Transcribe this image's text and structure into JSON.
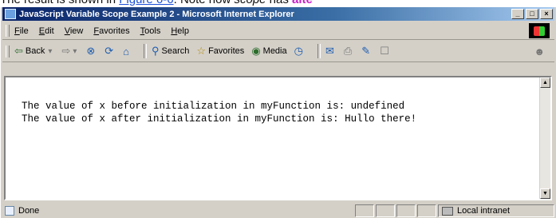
{
  "caption": {
    "prefix": "The result is shown in ",
    "link": "Figure 6-6",
    "middle": ". Note how ",
    "emphasis": "scope",
    "suffix": " has ",
    "highlight": "alte"
  },
  "window": {
    "title": "JavaScript Variable Scope Example 2 - Microsoft Internet Explorer",
    "controls": {
      "minimize": "_",
      "maximize": "□",
      "close": "×"
    }
  },
  "menu": {
    "items": [
      {
        "label": "File"
      },
      {
        "label": "Edit"
      },
      {
        "label": "View"
      },
      {
        "label": "Favorites"
      },
      {
        "label": "Tools"
      },
      {
        "label": "Help"
      }
    ]
  },
  "toolbar": {
    "back": {
      "label": "Back",
      "icon": "back-arrow-icon",
      "glyph": "⇦"
    },
    "back_drop": "▾",
    "forward": {
      "icon": "forward-arrow-icon",
      "glyph": "⇨"
    },
    "forward_drop": "▾",
    "stop_glyph": "⊗",
    "refresh_glyph": "⟳",
    "home_glyph": "⌂",
    "search": {
      "label": "Search",
      "glyph": "⚲"
    },
    "favorites": {
      "label": "Favorites",
      "glyph": "☆"
    },
    "media": {
      "label": "Media",
      "glyph": "◉"
    },
    "history_glyph": "◷",
    "mail_glyph": "✉",
    "print_glyph": "⎙",
    "edit_glyph": "✎",
    "discuss_glyph": "☐",
    "messenger_glyph": "☻"
  },
  "content": {
    "lines": [
      "The value of x before initialization in myFunction is: undefined",
      "The value of x after initialization in myFunction is: Hullo there!"
    ]
  },
  "statusbar": {
    "status": "Done",
    "zone": "Local intranet"
  },
  "scrollbar": {
    "up": "▲",
    "down": "▼"
  }
}
